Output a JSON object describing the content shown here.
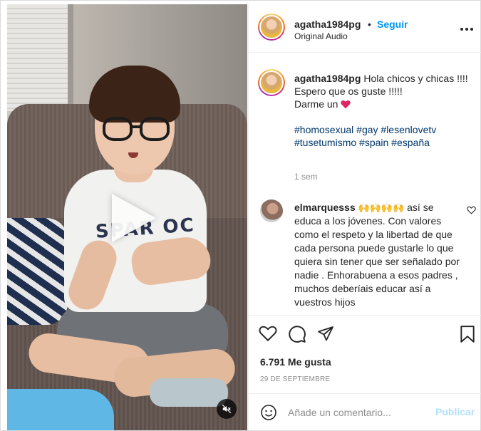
{
  "post": {
    "username": "agatha1984pg",
    "dot": "•",
    "follow_label": "Seguir",
    "audio_label": "Original Audio",
    "more_icon": "more-horizontal-icon"
  },
  "caption": {
    "username": "agatha1984pg",
    "lines": [
      "Hola chicos y chicas !!!!",
      "Espero que os guste !!!!!",
      "Darme un"
    ],
    "heart_emoji": "red-heart-emoji",
    "hashtags_line1": "#homosexual #gay #lesenlovetv",
    "hashtags_line2": "#tusetumismo #spain #españa",
    "time": "1 sem"
  },
  "comment": {
    "username": "elmarquesss",
    "claps": "🙌🙌🙌🙌",
    "text": "así se educa a los jóvenes. Con valores como el respeto y la libertad de que cada persona puede gustarle lo que quiera sin tener que ser señalado por nadie . Enhorabuena a esos padres , muchos deberíais educar así a vuestros hijos"
  },
  "video": {
    "shirt_print": "SPAR OC",
    "play_icon": "play-icon",
    "mute_icon": "speaker-muted-icon"
  },
  "actions": {
    "likes": "6.791 Me gusta",
    "date": "29 DE SEPTIEMBRE"
  },
  "composer": {
    "placeholder": "Añade un comentario...",
    "post_label": "Publicar"
  },
  "colors": {
    "accent": "#0095f6",
    "post_disabled": "#b2dffc",
    "hashtag": "#00376b",
    "muted": "#8e8e8e"
  }
}
